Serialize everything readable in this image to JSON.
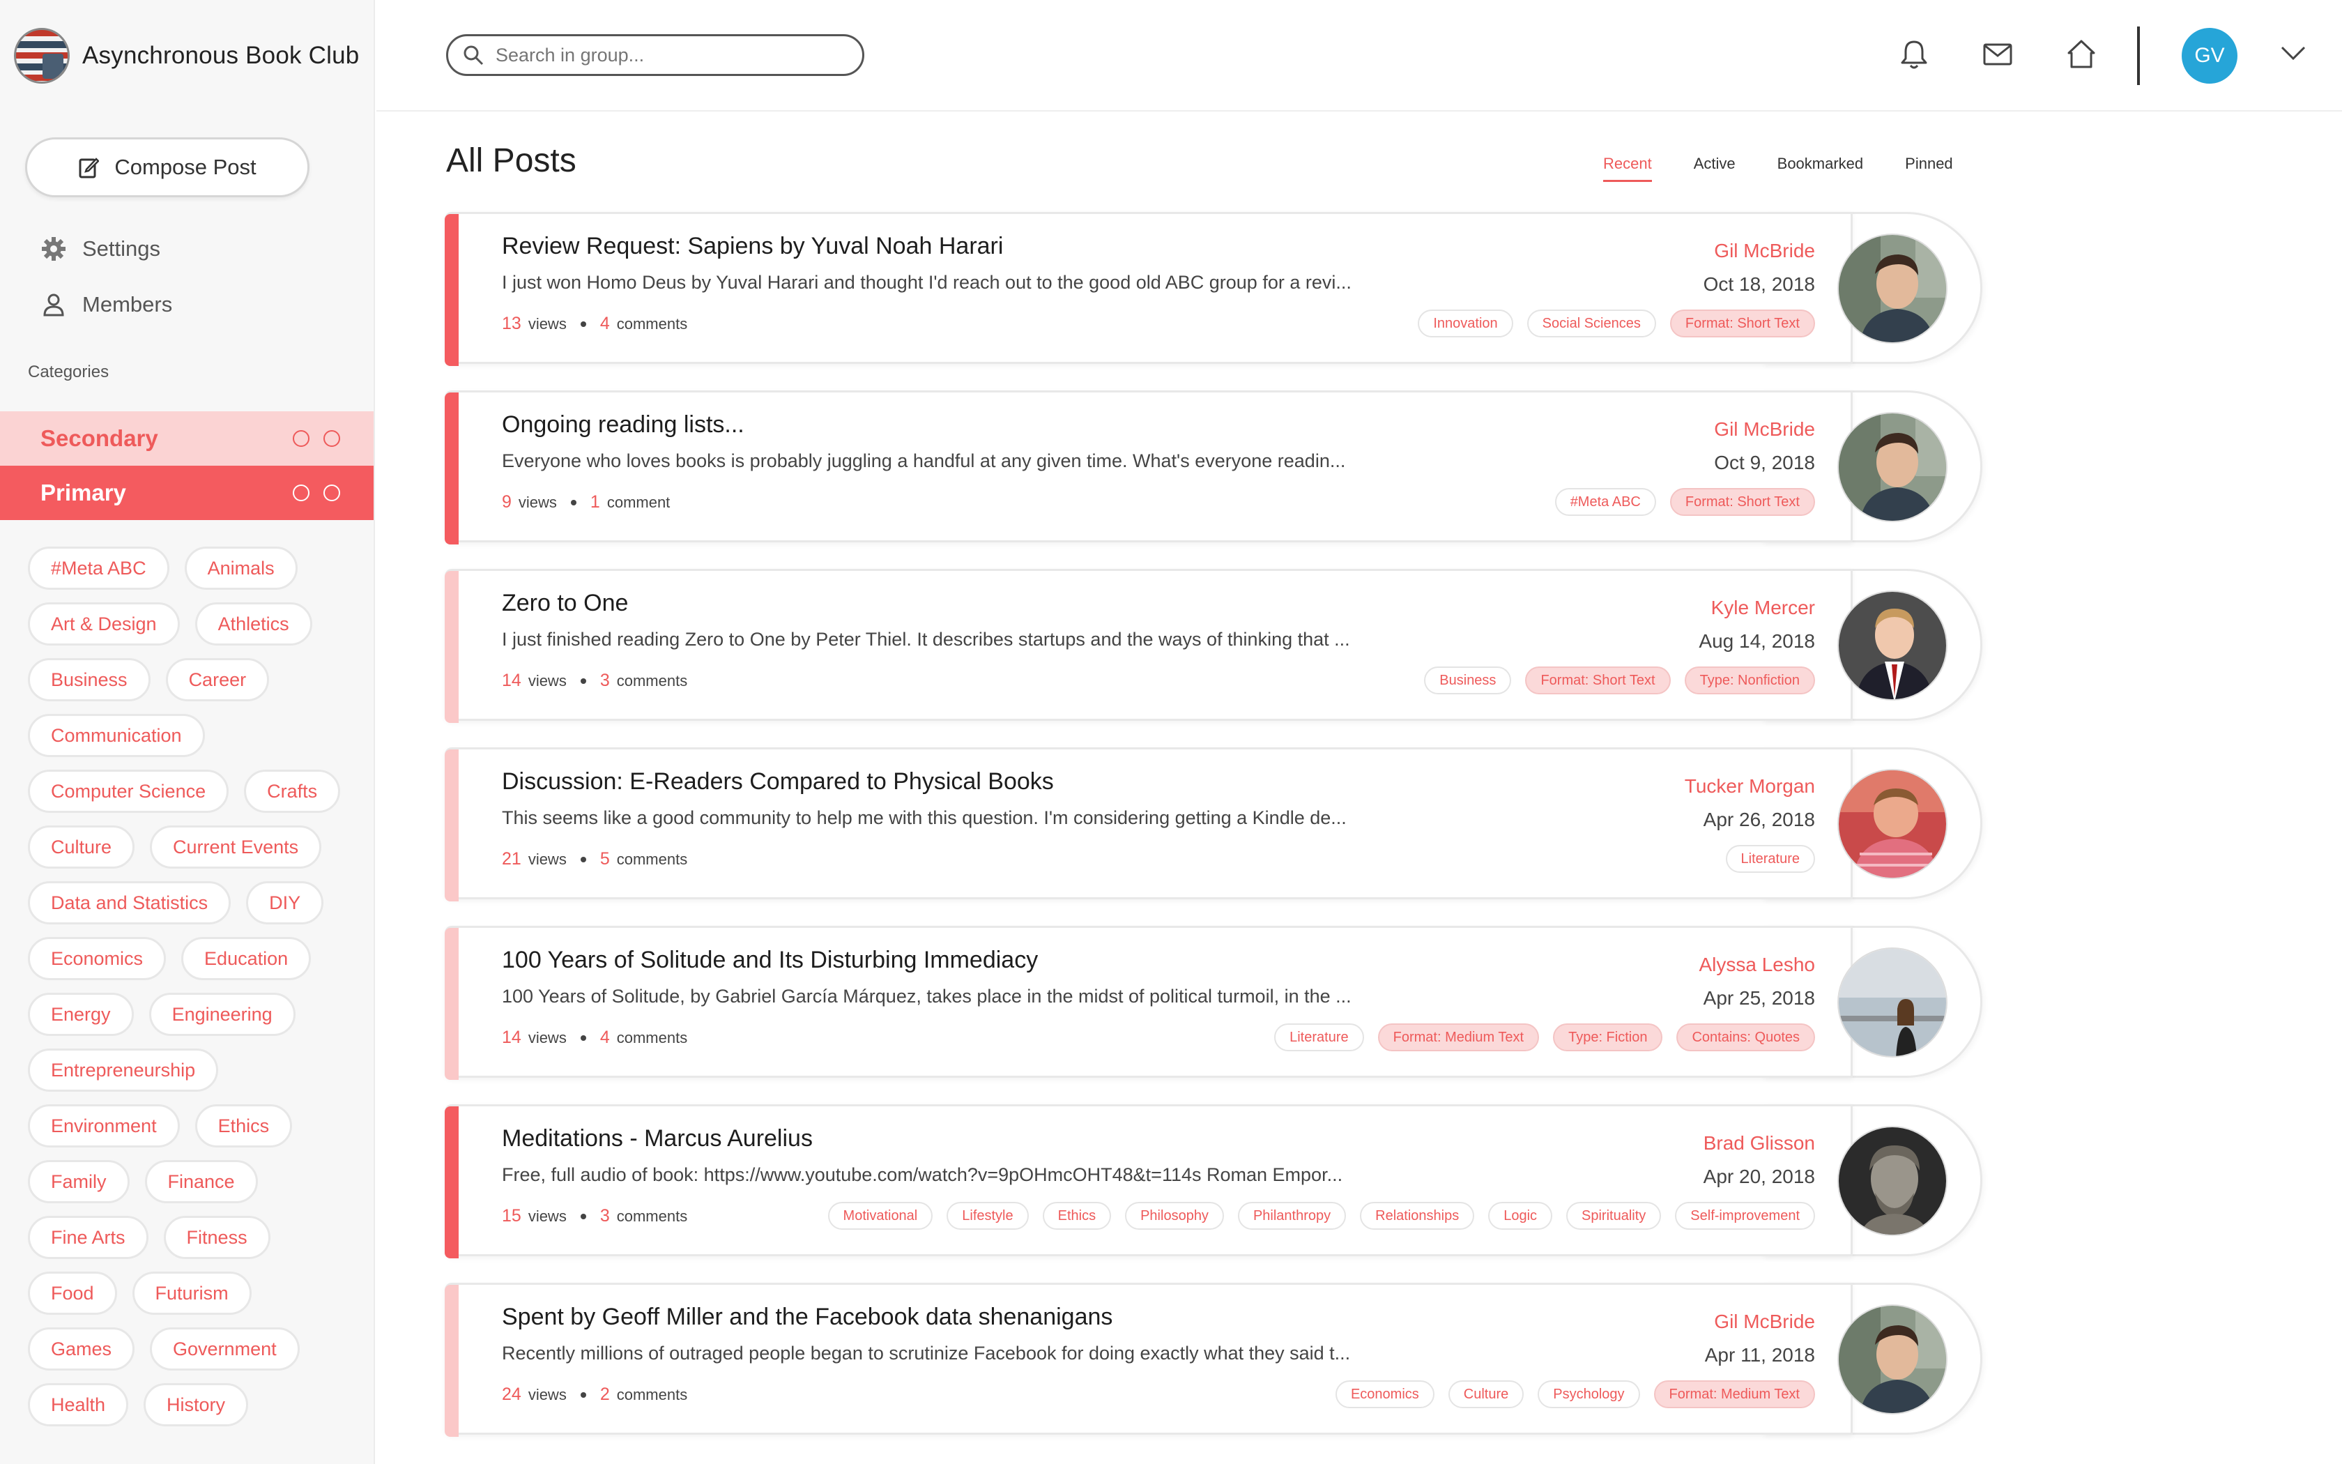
{
  "app": {
    "title": "Asynchronous Book Club"
  },
  "sidebar": {
    "compose_label": "Compose Post",
    "settings_label": "Settings",
    "members_label": "Members",
    "categories_title": "Categories",
    "categories": [
      {
        "label": "Secondary"
      },
      {
        "label": "Primary"
      }
    ],
    "tags": [
      "#Meta ABC",
      "Animals",
      "Art & Design",
      "Athletics",
      "Business",
      "Career",
      "Communication",
      "Computer Science",
      "Crafts",
      "Culture",
      "Current Events",
      "Data and Statistics",
      "DIY",
      "Economics",
      "Education",
      "Energy",
      "Engineering",
      "Entrepreneurship",
      "Environment",
      "Ethics",
      "Family",
      "Finance",
      "Fine Arts",
      "Fitness",
      "Food",
      "Futurism",
      "Games",
      "Government",
      "Health",
      "History"
    ]
  },
  "header": {
    "search_placeholder": "Search in group...",
    "user_initials": "GV",
    "icons": [
      "bell-icon",
      "mail-icon",
      "home-icon",
      "chevron-down-icon"
    ]
  },
  "main": {
    "title": "All Posts",
    "sort_tabs": [
      "Recent",
      "Active",
      "Bookmarked",
      "Pinned"
    ],
    "active_sort": "Recent",
    "posts": [
      {
        "title": "Review Request: Sapiens by Yuval Noah Harari",
        "excerpt": "I just won Homo Deus by Yuval Harari and thought I'd reach out to the good old ABC group for a revi...",
        "views": "13",
        "views_label": "views",
        "comments": "4",
        "comments_label": "comments",
        "author": "Gil McBride",
        "date": "Oct 18, 2018",
        "tags": [
          {
            "label": "Innovation",
            "filled": false
          },
          {
            "label": "Social Sciences",
            "filled": false
          },
          {
            "label": "Format: Short Text",
            "filled": true
          }
        ],
        "accent": "strong",
        "avatar": "gil"
      },
      {
        "title": "Ongoing reading lists...",
        "excerpt": "Everyone who loves books is probably juggling a handful at any given time. What's everyone readin...",
        "views": "9",
        "views_label": "views",
        "comments": "1",
        "comments_label": "comment",
        "author": "Gil McBride",
        "date": "Oct 9, 2018",
        "tags": [
          {
            "label": "#Meta ABC",
            "filled": false
          },
          {
            "label": "Format: Short Text",
            "filled": true
          }
        ],
        "accent": "strong",
        "avatar": "gil"
      },
      {
        "title": "Zero to One",
        "excerpt": "I just finished reading Zero to One by Peter Thiel. It describes startups and the ways of thinking that ...",
        "views": "14",
        "views_label": "views",
        "comments": "3",
        "comments_label": "comments",
        "author": "Kyle Mercer",
        "date": "Aug 14, 2018",
        "tags": [
          {
            "label": "Business",
            "filled": false
          },
          {
            "label": "Format: Short Text",
            "filled": true
          },
          {
            "label": "Type: Nonfiction",
            "filled": true
          }
        ],
        "accent": "light",
        "avatar": "kyle"
      },
      {
        "title": "Discussion: E-Readers Compared to Physical Books",
        "excerpt": "This seems like a good community to help me with this question. I'm considering getting a Kindle de...",
        "views": "21",
        "views_label": "views",
        "comments": "5",
        "comments_label": "comments",
        "author": "Tucker Morgan",
        "date": "Apr 26, 2018",
        "tags": [
          {
            "label": "Literature",
            "filled": false
          }
        ],
        "accent": "light",
        "avatar": "tucker"
      },
      {
        "title": "100 Years of Solitude and Its Disturbing Immediacy",
        "excerpt": "100 Years of Solitude, by Gabriel García Márquez, takes place in the midst of political turmoil, in the ...",
        "views": "14",
        "views_label": "views",
        "comments": "4",
        "comments_label": "comments",
        "author": "Alyssa Lesho",
        "date": "Apr 25, 2018",
        "tags": [
          {
            "label": "Literature",
            "filled": false
          },
          {
            "label": "Format: Medium Text",
            "filled": true
          },
          {
            "label": "Type: Fiction",
            "filled": true
          },
          {
            "label": "Contains: Quotes",
            "filled": true
          }
        ],
        "accent": "light",
        "avatar": "alyssa"
      },
      {
        "title": "Meditations - Marcus Aurelius",
        "excerpt": "Free, full audio of book: https://www.youtube.com/watch?v=9pOHmcOHT48&t=114s Roman Empor...",
        "views": "15",
        "views_label": "views",
        "comments": "3",
        "comments_label": "comments",
        "author": "Brad Glisson",
        "date": "Apr 20, 2018",
        "tags": [
          {
            "label": "Motivational",
            "filled": false
          },
          {
            "label": "Lifestyle",
            "filled": false
          },
          {
            "label": "Ethics",
            "filled": false
          },
          {
            "label": "Philosophy",
            "filled": false
          },
          {
            "label": "Philanthropy",
            "filled": false
          },
          {
            "label": "Relationships",
            "filled": false
          },
          {
            "label": "Logic",
            "filled": false
          },
          {
            "label": "Spirituality",
            "filled": false
          },
          {
            "label": "Self-improvement",
            "filled": false
          }
        ],
        "accent": "strong",
        "avatar": "brad"
      },
      {
        "title": "Spent by Geoff Miller and the Facebook data shenanigans",
        "excerpt": "Recently millions of outraged people began to scrutinize Facebook for doing exactly what they said t...",
        "views": "24",
        "views_label": "views",
        "comments": "2",
        "comments_label": "comments",
        "author": "Gil McBride",
        "date": "Apr 11, 2018",
        "tags": [
          {
            "label": "Economics",
            "filled": false
          },
          {
            "label": "Culture",
            "filled": false
          },
          {
            "label": "Psychology",
            "filled": false
          },
          {
            "label": "Format: Medium Text",
            "filled": true
          }
        ],
        "accent": "light",
        "avatar": "gil"
      }
    ]
  },
  "colors": {
    "accent": "#ee5a5a",
    "accent_strong": "#f45b5f",
    "accent_light": "#fbc8c8",
    "primary_row": "#f45b5f",
    "secondary_row": "#fbd3d3",
    "avatar_gv": "#26a5d8"
  }
}
